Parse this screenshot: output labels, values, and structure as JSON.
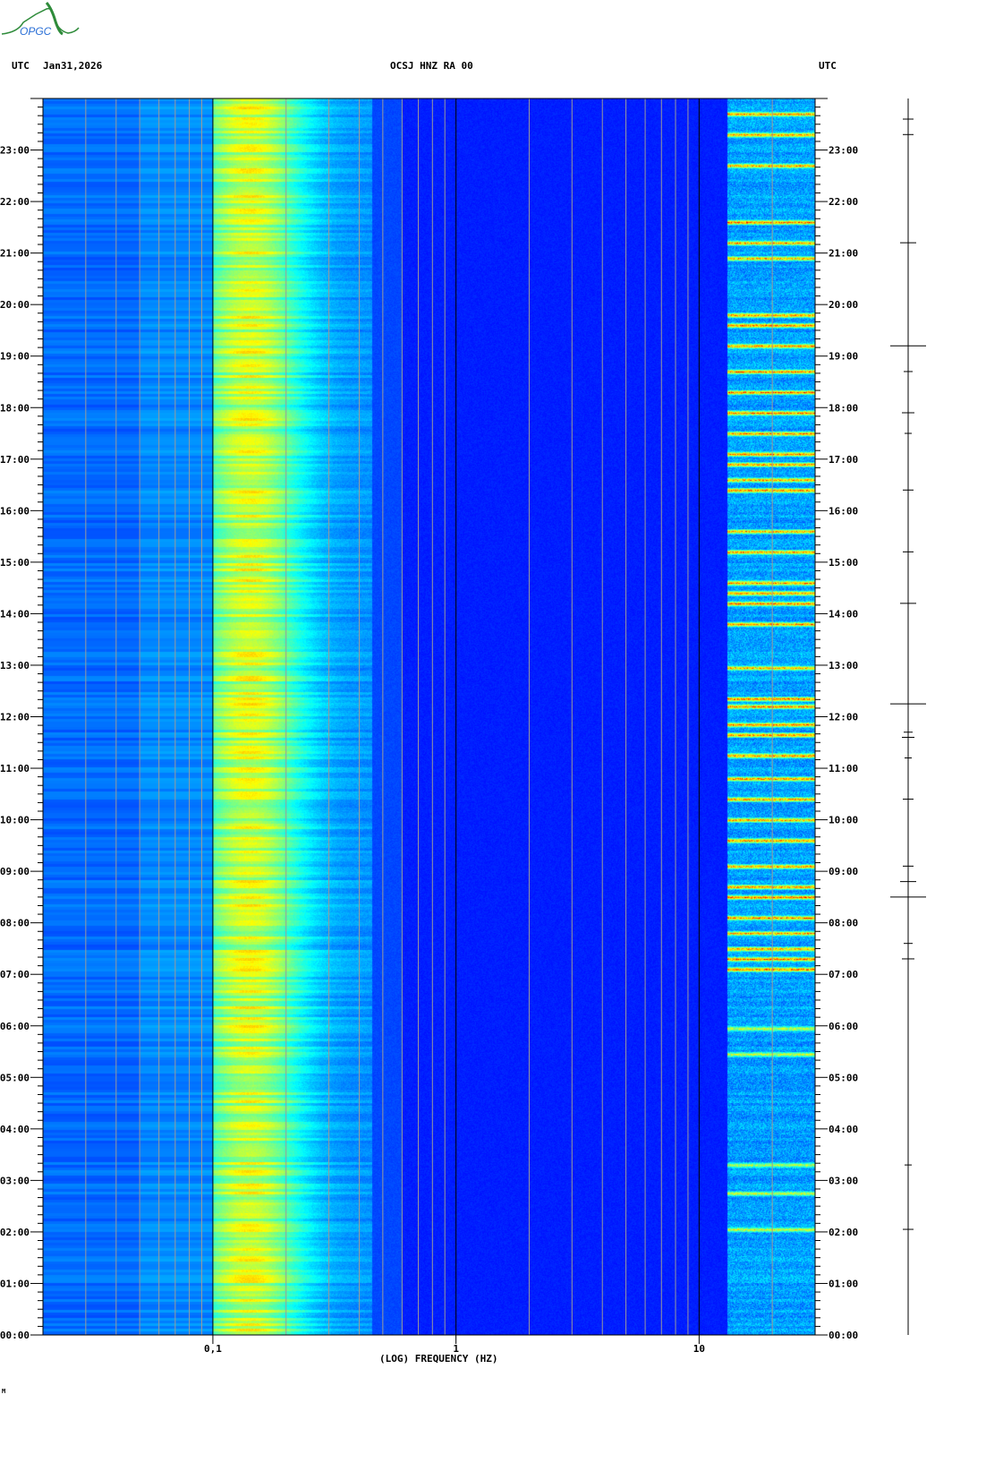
{
  "header": {
    "left_tz": "UTC",
    "date": "Jan31,2026",
    "station": "OCSJ HNZ RA 00",
    "right_tz": "UTC"
  },
  "logo": {
    "text": "OPGC"
  },
  "footer_mark": "M",
  "colors": {
    "grid_minor": "#9a9a9a",
    "grid_major": "#000000",
    "trace": "#000000"
  },
  "chart_data": {
    "type": "heatmap",
    "title": "OCSJ HNZ RA 00",
    "xlabel": "(LOG) FREQUENCY (HZ)",
    "ylabel": "UTC",
    "x_scale": "log",
    "xlim": [
      0.02,
      30
    ],
    "x_ticks": [
      {
        "value": 0.1,
        "label": "0,1"
      },
      {
        "value": 1,
        "label": "1"
      },
      {
        "value": 10,
        "label": "10"
      }
    ],
    "x_gridlines": [
      0.03,
      0.04,
      0.05,
      0.06,
      0.07,
      0.08,
      0.09,
      0.1,
      0.2,
      0.3,
      0.4,
      0.5,
      0.6,
      0.7,
      0.8,
      0.9,
      1,
      2,
      3,
      4,
      5,
      6,
      7,
      8,
      9,
      10,
      20
    ],
    "ylim_hours": [
      0,
      24
    ],
    "y_ticks": [
      "00:00",
      "01:00",
      "02:00",
      "03:00",
      "04:00",
      "05:00",
      "06:00",
      "07:00",
      "08:00",
      "09:00",
      "10:00",
      "11:00",
      "12:00",
      "13:00",
      "14:00",
      "15:00",
      "16:00",
      "17:00",
      "18:00",
      "19:00",
      "20:00",
      "21:00",
      "22:00",
      "23:00"
    ],
    "y_minor_tick_minutes": 10,
    "colormap": "jet",
    "dominant_band_hz": [
      0.12,
      0.2
    ],
    "high_freq_activity_hz": [
      13,
      30
    ],
    "active_period_hours": [
      7.0,
      23.8
    ],
    "event_hours": [
      2.05,
      2.75,
      3.3,
      5.45,
      5.95,
      7.1,
      7.3,
      7.5,
      7.8,
      8.1,
      8.5,
      8.7,
      9.1,
      9.6,
      10.0,
      10.4,
      10.8,
      11.25,
      11.65,
      11.85,
      12.2,
      12.35,
      12.95,
      13.8,
      14.2,
      14.4,
      14.6,
      15.2,
      15.6,
      16.4,
      16.6,
      16.9,
      17.1,
      17.5,
      17.9,
      18.3,
      18.7,
      19.2,
      19.6,
      19.8,
      20.9,
      21.2,
      21.6,
      22.7,
      23.3,
      23.7
    ],
    "trace_event_hours": [
      2.05,
      3.3,
      7.3,
      7.6,
      8.5,
      8.8,
      9.1,
      10.4,
      11.2,
      11.6,
      11.7,
      12.25,
      14.2,
      15.2,
      16.4,
      17.5,
      17.9,
      18.7,
      19.2,
      21.2,
      23.3,
      23.6
    ]
  }
}
